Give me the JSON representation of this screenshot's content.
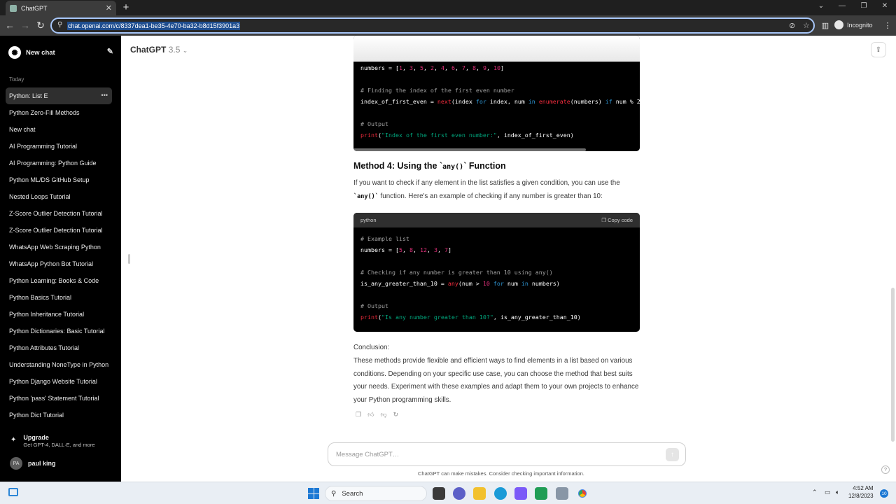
{
  "browser": {
    "tab_title": "ChatGPT",
    "url": "chat.openai.com/c/8337dea1-be35-4e70-ba32-b8d15f3901a3",
    "incognito_label": "Incognito"
  },
  "sidebar": {
    "new_chat_label": "New chat",
    "section_today": "Today",
    "items": [
      {
        "label": "Python: List E"
      },
      {
        "label": "Python Zero-Fill Methods"
      },
      {
        "label": "New chat"
      },
      {
        "label": "AI Programming Tutorial"
      },
      {
        "label": "AI Programming: Python Guide"
      },
      {
        "label": "Python ML/DS GitHub Setup"
      },
      {
        "label": "Nested Loops Tutorial"
      },
      {
        "label": "Z-Score Outlier Detection Tutorial"
      },
      {
        "label": "Z-Score Outlier Detection Tutorial"
      },
      {
        "label": "WhatsApp Web Scraping Python"
      },
      {
        "label": "WhatsApp Python Bot Tutorial"
      },
      {
        "label": "Python Learning: Books & Code"
      },
      {
        "label": "Python Basics Tutorial"
      },
      {
        "label": "Python Inheritance Tutorial"
      },
      {
        "label": "Python Dictionaries: Basic Tutorial"
      },
      {
        "label": "Python Attributes Tutorial"
      },
      {
        "label": "Understanding NoneType in Python"
      },
      {
        "label": "Python Django Website Tutorial"
      },
      {
        "label": "Python 'pass' Statement Tutorial"
      },
      {
        "label": "Python Dict Tutorial"
      }
    ],
    "upgrade_title": "Upgrade",
    "upgrade_subtitle": "Get GPT-4, DALL·E, and more",
    "user_initials": "PA",
    "user_name": "paul king"
  },
  "header": {
    "model_name": "ChatGPT",
    "model_version": "3.5"
  },
  "content": {
    "method4_prefix": "Method 4: Using the `",
    "method4_code": "any()",
    "method4_suffix": "` Function",
    "para1_a": "If you want to check if any element in the list satisfies a given condition, you can use the",
    "para1_code": "`any()`",
    "para1_b": " function. Here's an example of checking if any number is greater than 10:",
    "code_lang": "python",
    "copy_code_label": "Copy code",
    "conclusion_label": "Conclusion:",
    "conclusion_text": "These methods provide flexible and efficient ways to find elements in a list based on various conditions. Depending on your specific use case, you can choose the method that best suits your needs. Experiment with these examples and adapt them to your own projects to enhance your Python programming skills."
  },
  "composer": {
    "placeholder": "Message ChatGPT…",
    "disclaimer": "ChatGPT can make mistakes. Consider checking important information."
  },
  "taskbar": {
    "search_label": "Search",
    "time": "4:52 AM",
    "date": "12/8/2023",
    "notif_count": "10"
  }
}
